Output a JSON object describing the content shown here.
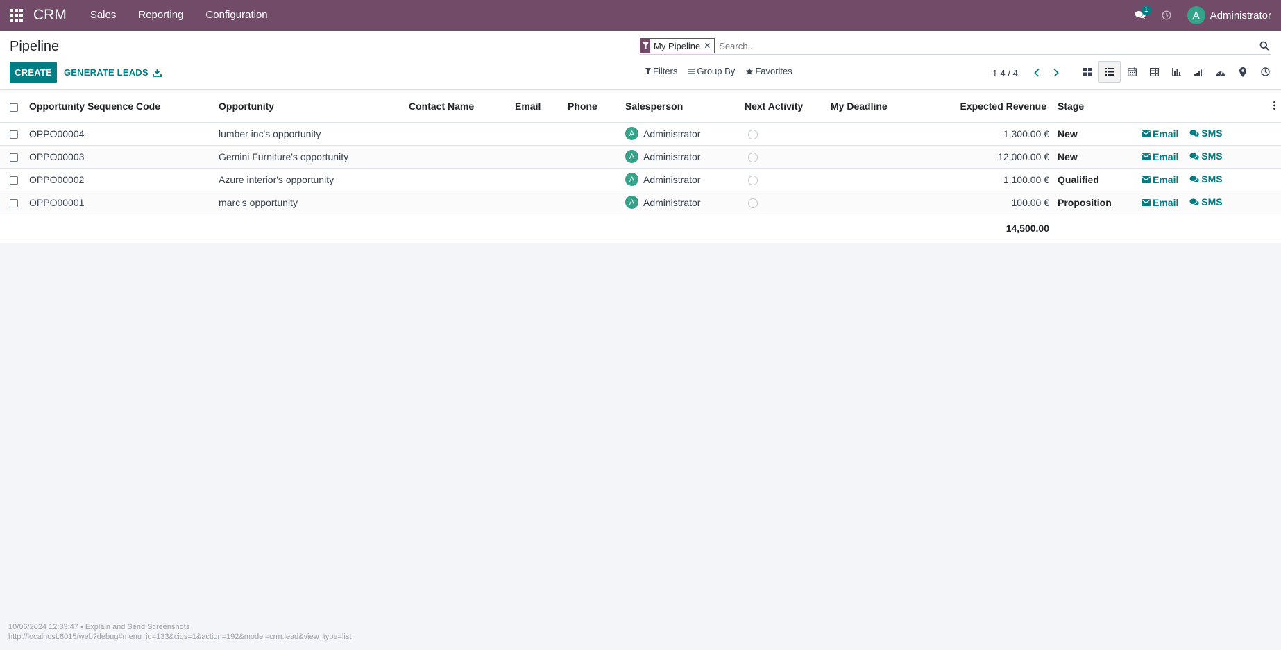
{
  "nav": {
    "brand": "CRM",
    "menu": [
      "Sales",
      "Reporting",
      "Configuration"
    ],
    "chat_badge": "1",
    "avatar_letter": "A",
    "user_name": "Administrator",
    "bar_color": "#714b67"
  },
  "control": {
    "title": "Pipeline",
    "create_label": "CREATE",
    "generate_label": "GENERATE LEADS",
    "facet_label": "My Pipeline",
    "search_placeholder": "Search...",
    "filters_label": "Filters",
    "groupby_label": "Group By",
    "favorites_label": "Favorites",
    "pager": "1-4 / 4",
    "accent": "#017e84"
  },
  "table": {
    "headers": {
      "sequence": "Opportunity Sequence Code",
      "opportunity": "Opportunity",
      "contact": "Contact Name",
      "email": "Email",
      "phone": "Phone",
      "salesperson": "Salesperson",
      "next_activity": "Next Activity",
      "deadline": "My Deadline",
      "revenue": "Expected Revenue",
      "stage": "Stage"
    },
    "rows": [
      {
        "code": "OPPO00004",
        "name": "lumber inc's opportunity",
        "contact": "",
        "email": "",
        "phone": "",
        "avatar": "A",
        "salesperson": "Administrator",
        "deadline": "",
        "revenue": "1,300.00 €",
        "stage": "New",
        "email_btn": "Email",
        "sms_btn": "SMS"
      },
      {
        "code": "OPPO00003",
        "name": "Gemini Furniture's opportunity",
        "contact": "",
        "email": "",
        "phone": "",
        "avatar": "A",
        "salesperson": "Administrator",
        "deadline": "",
        "revenue": "12,000.00 €",
        "stage": "New",
        "email_btn": "Email",
        "sms_btn": "SMS"
      },
      {
        "code": "OPPO00002",
        "name": "Azure interior's opportunity",
        "contact": "",
        "email": "",
        "phone": "",
        "avatar": "A",
        "salesperson": "Administrator",
        "deadline": "",
        "revenue": "1,100.00 €",
        "stage": "Qualified",
        "email_btn": "Email",
        "sms_btn": "SMS"
      },
      {
        "code": "OPPO00001",
        "name": "marc's opportunity",
        "contact": "",
        "email": "",
        "phone": "",
        "avatar": "A",
        "salesperson": "Administrator",
        "deadline": "",
        "revenue": "100.00 €",
        "stage": "Proposition",
        "email_btn": "Email",
        "sms_btn": "SMS"
      }
    ],
    "total": "14,500.00"
  },
  "footer": {
    "line1": "10/06/2024 12:33:47 • Explain and Send Screenshots",
    "line2": "http://localhost:8015/web?debug#menu_id=133&cids=1&action=192&model=crm.lead&view_type=list"
  },
  "icons": [
    "apps-icon",
    "chat-icon",
    "clock-icon",
    "filter-icon",
    "close-icon",
    "search-icon",
    "download-icon",
    "bars-icon",
    "star-icon",
    "chevron-left-icon",
    "chevron-right-icon",
    "kanban-icon",
    "list-icon",
    "calendar-icon",
    "pivot-icon",
    "graph-icon",
    "cohort-icon",
    "dashboard-icon",
    "map-pin-icon",
    "activity-icon",
    "kebab-icon",
    "envelope-icon",
    "sms-icon"
  ]
}
